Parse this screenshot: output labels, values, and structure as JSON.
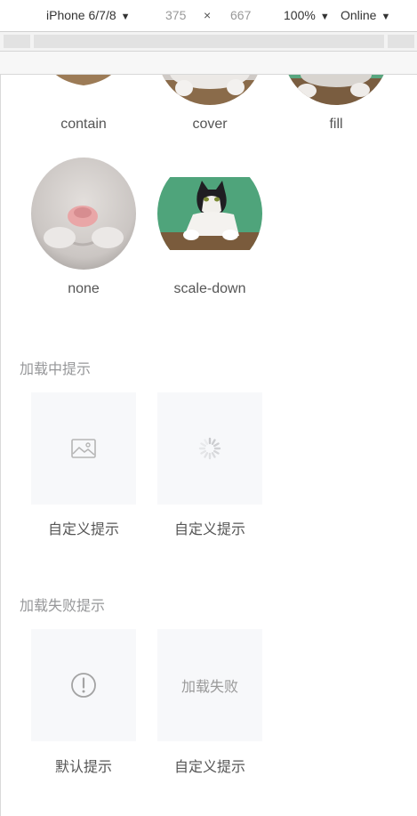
{
  "devtools": {
    "device": "iPhone 6/7/8",
    "width": "375",
    "times": "×",
    "height": "667",
    "zoom": "100%",
    "network": "Online"
  },
  "fit_row1": [
    "contain",
    "cover",
    "fill"
  ],
  "fit_row2": [
    "none",
    "scale-down"
  ],
  "loading": {
    "title": "加载中提示",
    "captions": [
      "自定义提示",
      "自定义提示"
    ]
  },
  "error": {
    "title": "加载失败提示",
    "custom_text": "加载失败",
    "captions": [
      "默认提示",
      "自定义提示"
    ]
  },
  "colors": {
    "placeholder_bg": "#f7f8fa",
    "section_title": "#969799",
    "caption": "#555555",
    "icon": "#999999"
  }
}
